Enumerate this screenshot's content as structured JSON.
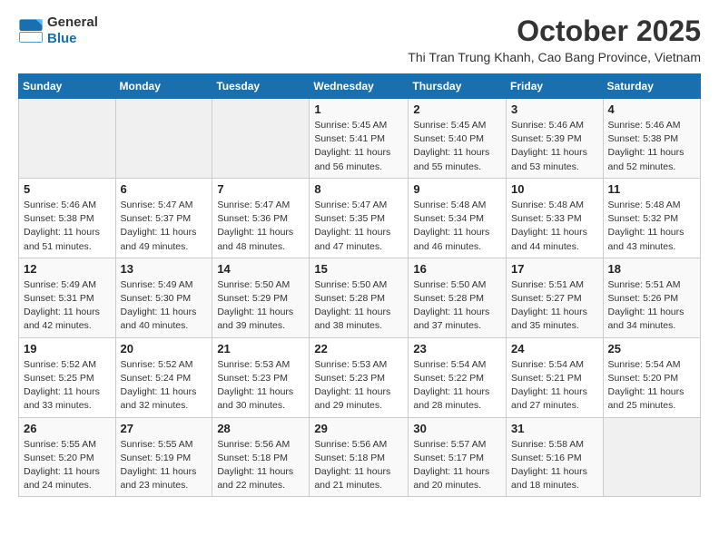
{
  "header": {
    "logo_general": "General",
    "logo_blue": "Blue",
    "month_title": "October 2025",
    "subtitle": "Thi Tran Trung Khanh, Cao Bang Province, Vietnam"
  },
  "weekdays": [
    "Sunday",
    "Monday",
    "Tuesday",
    "Wednesday",
    "Thursday",
    "Friday",
    "Saturday"
  ],
  "weeks": [
    [
      {
        "day": "",
        "info": ""
      },
      {
        "day": "",
        "info": ""
      },
      {
        "day": "",
        "info": ""
      },
      {
        "day": "1",
        "info": "Sunrise: 5:45 AM\nSunset: 5:41 PM\nDaylight: 11 hours\nand 56 minutes."
      },
      {
        "day": "2",
        "info": "Sunrise: 5:45 AM\nSunset: 5:40 PM\nDaylight: 11 hours\nand 55 minutes."
      },
      {
        "day": "3",
        "info": "Sunrise: 5:46 AM\nSunset: 5:39 PM\nDaylight: 11 hours\nand 53 minutes."
      },
      {
        "day": "4",
        "info": "Sunrise: 5:46 AM\nSunset: 5:38 PM\nDaylight: 11 hours\nand 52 minutes."
      }
    ],
    [
      {
        "day": "5",
        "info": "Sunrise: 5:46 AM\nSunset: 5:38 PM\nDaylight: 11 hours\nand 51 minutes."
      },
      {
        "day": "6",
        "info": "Sunrise: 5:47 AM\nSunset: 5:37 PM\nDaylight: 11 hours\nand 49 minutes."
      },
      {
        "day": "7",
        "info": "Sunrise: 5:47 AM\nSunset: 5:36 PM\nDaylight: 11 hours\nand 48 minutes."
      },
      {
        "day": "8",
        "info": "Sunrise: 5:47 AM\nSunset: 5:35 PM\nDaylight: 11 hours\nand 47 minutes."
      },
      {
        "day": "9",
        "info": "Sunrise: 5:48 AM\nSunset: 5:34 PM\nDaylight: 11 hours\nand 46 minutes."
      },
      {
        "day": "10",
        "info": "Sunrise: 5:48 AM\nSunset: 5:33 PM\nDaylight: 11 hours\nand 44 minutes."
      },
      {
        "day": "11",
        "info": "Sunrise: 5:48 AM\nSunset: 5:32 PM\nDaylight: 11 hours\nand 43 minutes."
      }
    ],
    [
      {
        "day": "12",
        "info": "Sunrise: 5:49 AM\nSunset: 5:31 PM\nDaylight: 11 hours\nand 42 minutes."
      },
      {
        "day": "13",
        "info": "Sunrise: 5:49 AM\nSunset: 5:30 PM\nDaylight: 11 hours\nand 40 minutes."
      },
      {
        "day": "14",
        "info": "Sunrise: 5:50 AM\nSunset: 5:29 PM\nDaylight: 11 hours\nand 39 minutes."
      },
      {
        "day": "15",
        "info": "Sunrise: 5:50 AM\nSunset: 5:28 PM\nDaylight: 11 hours\nand 38 minutes."
      },
      {
        "day": "16",
        "info": "Sunrise: 5:50 AM\nSunset: 5:28 PM\nDaylight: 11 hours\nand 37 minutes."
      },
      {
        "day": "17",
        "info": "Sunrise: 5:51 AM\nSunset: 5:27 PM\nDaylight: 11 hours\nand 35 minutes."
      },
      {
        "day": "18",
        "info": "Sunrise: 5:51 AM\nSunset: 5:26 PM\nDaylight: 11 hours\nand 34 minutes."
      }
    ],
    [
      {
        "day": "19",
        "info": "Sunrise: 5:52 AM\nSunset: 5:25 PM\nDaylight: 11 hours\nand 33 minutes."
      },
      {
        "day": "20",
        "info": "Sunrise: 5:52 AM\nSunset: 5:24 PM\nDaylight: 11 hours\nand 32 minutes."
      },
      {
        "day": "21",
        "info": "Sunrise: 5:53 AM\nSunset: 5:23 PM\nDaylight: 11 hours\nand 30 minutes."
      },
      {
        "day": "22",
        "info": "Sunrise: 5:53 AM\nSunset: 5:23 PM\nDaylight: 11 hours\nand 29 minutes."
      },
      {
        "day": "23",
        "info": "Sunrise: 5:54 AM\nSunset: 5:22 PM\nDaylight: 11 hours\nand 28 minutes."
      },
      {
        "day": "24",
        "info": "Sunrise: 5:54 AM\nSunset: 5:21 PM\nDaylight: 11 hours\nand 27 minutes."
      },
      {
        "day": "25",
        "info": "Sunrise: 5:54 AM\nSunset: 5:20 PM\nDaylight: 11 hours\nand 25 minutes."
      }
    ],
    [
      {
        "day": "26",
        "info": "Sunrise: 5:55 AM\nSunset: 5:20 PM\nDaylight: 11 hours\nand 24 minutes."
      },
      {
        "day": "27",
        "info": "Sunrise: 5:55 AM\nSunset: 5:19 PM\nDaylight: 11 hours\nand 23 minutes."
      },
      {
        "day": "28",
        "info": "Sunrise: 5:56 AM\nSunset: 5:18 PM\nDaylight: 11 hours\nand 22 minutes."
      },
      {
        "day": "29",
        "info": "Sunrise: 5:56 AM\nSunset: 5:18 PM\nDaylight: 11 hours\nand 21 minutes."
      },
      {
        "day": "30",
        "info": "Sunrise: 5:57 AM\nSunset: 5:17 PM\nDaylight: 11 hours\nand 20 minutes."
      },
      {
        "day": "31",
        "info": "Sunrise: 5:58 AM\nSunset: 5:16 PM\nDaylight: 11 hours\nand 18 minutes."
      },
      {
        "day": "",
        "info": ""
      }
    ]
  ]
}
